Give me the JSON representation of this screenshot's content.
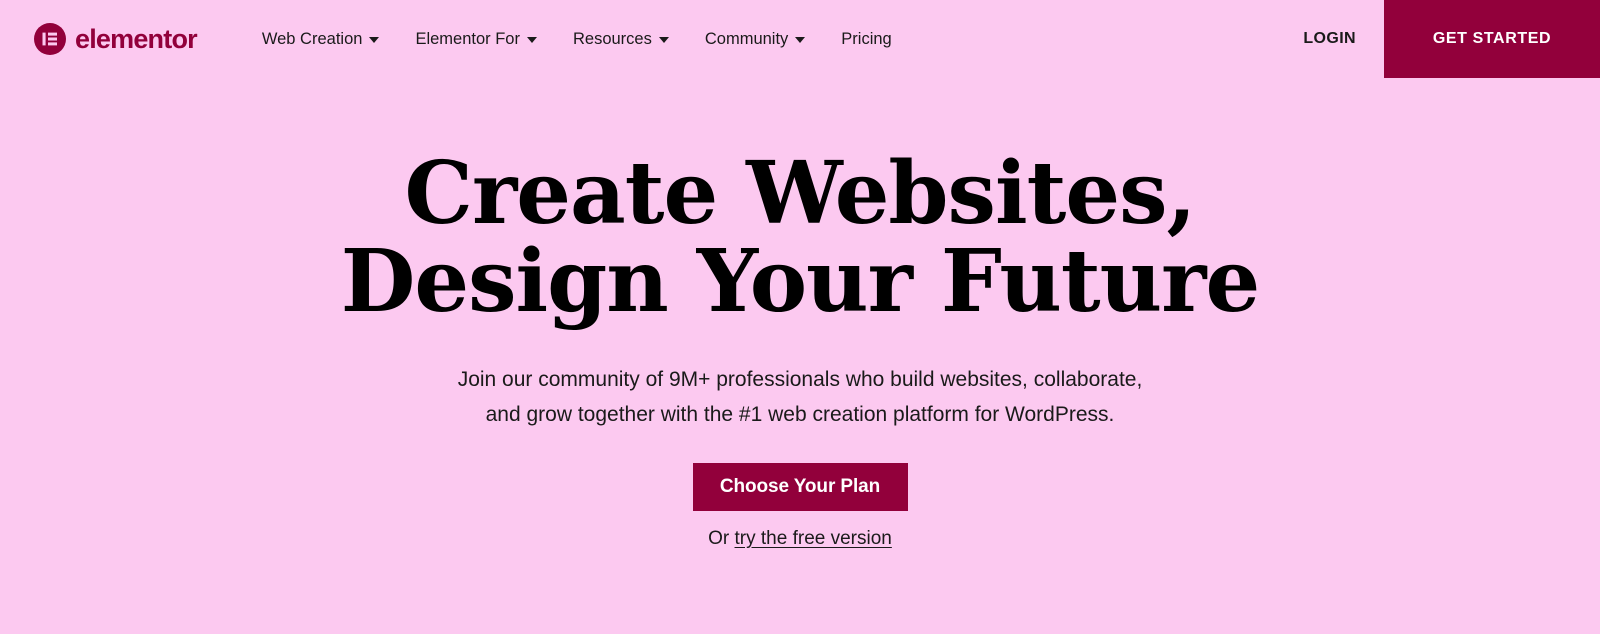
{
  "theme": {
    "page_background": "#fcc9f0",
    "brand_color": "#92003b",
    "text_color": "#1a1a1a",
    "heading_color": "#000000",
    "cta_text_color": "#ffffff"
  },
  "header": {
    "logo": {
      "icon": "elementor-e-logo-icon",
      "wordmark": "elementor"
    },
    "nav": [
      {
        "label": "Web Creation",
        "has_dropdown": true,
        "caret_icon": "chevron-down-icon"
      },
      {
        "label": "Elementor For",
        "has_dropdown": true,
        "caret_icon": "chevron-down-icon"
      },
      {
        "label": "Resources",
        "has_dropdown": true,
        "caret_icon": "chevron-down-icon"
      },
      {
        "label": "Community",
        "has_dropdown": true,
        "caret_icon": "chevron-down-icon"
      },
      {
        "label": "Pricing",
        "has_dropdown": false,
        "caret_icon": ""
      }
    ],
    "login_label": "LOGIN",
    "get_started_label": "GET STARTED"
  },
  "hero": {
    "title_line1": "Create Websites,",
    "title_line2": "Design Your Future",
    "subtitle_line1": "Join our community of 9M+ professionals who build websites, collaborate,",
    "subtitle_line2": "and grow together with the #1 web creation platform for WordPress.",
    "primary_cta_label": "Choose Your Plan",
    "secondary_prefix": "Or ",
    "secondary_link_label": "try the free version"
  }
}
